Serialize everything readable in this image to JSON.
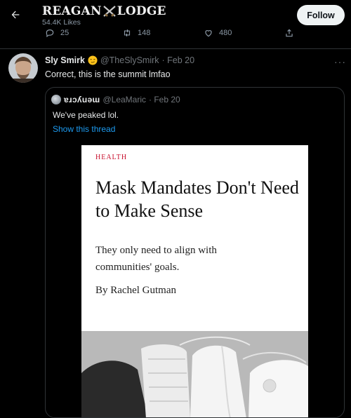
{
  "header": {
    "title_left": "REAGAN",
    "title_right": "LODGE",
    "likes": "54.4K Likes",
    "follow_label": "Follow"
  },
  "actions": {
    "replies": "25",
    "retweets": "148",
    "likes": "480"
  },
  "tweet": {
    "name": "Sly Smirk",
    "handle": "@TheSlySmirk",
    "date": "· Feb 20",
    "text": "Correct, this is the summit lmfao"
  },
  "quote": {
    "name": "ɐɹɔʎuǝɯ",
    "handle": "@LeaMaric",
    "date": "· Feb 20",
    "text": "We've peaked lol.",
    "link": "Show this thread"
  },
  "article": {
    "kicker": "HEALTH",
    "headline": "Mask Mandates Don't Need to Make Sense",
    "dek": "They only need to align with communities' goals.",
    "byline": "By Rachel Gutman"
  },
  "colors": {
    "background": "#000000",
    "link": "#1d9bf0",
    "kicker": "#c8102e"
  }
}
